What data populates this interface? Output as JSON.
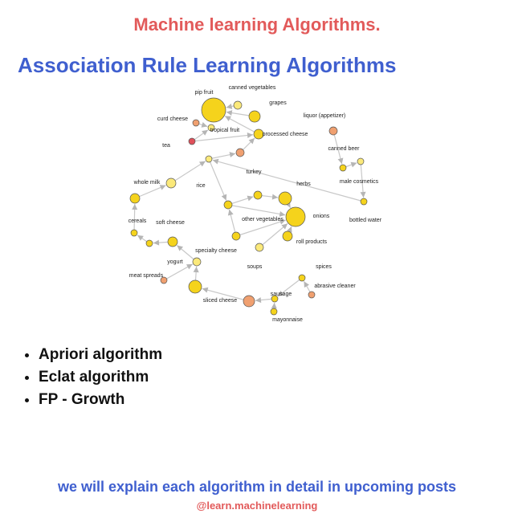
{
  "header": {
    "title": "Machine learning Algorithms.",
    "subtitle": "Association Rule Learning Algorithms"
  },
  "graph": {
    "items": [
      "pip fruit",
      "canned vegetables",
      "grapes",
      "liquor (appetizer)",
      "curd cheese",
      "tropical fruit",
      "processed cheese",
      "tea",
      "canned beer",
      "turkey",
      "male cosmetics",
      "whole milk",
      "rice",
      "herbs",
      "bottled water",
      "other vegetables",
      "onions",
      "cereals",
      "soft cheese",
      "roll products",
      "specialty cheese",
      "soups",
      "spices",
      "yogurt",
      "meat spreads",
      "abrasive cleaner",
      "sausage",
      "sliced cheese",
      "mayonnaise"
    ],
    "colors": {
      "light": "#fbe97a",
      "yellow": "#f5d31c",
      "orange": "#f0a070",
      "red": "#e0505a",
      "edge": "#c8c8c8"
    }
  },
  "algorithms": [
    "Apriori algorithm",
    "Eclat algorithm",
    "FP - Growth"
  ],
  "footer": {
    "note": "we will explain each algorithm in detail in upcoming posts",
    "handle": "@learn.machinelearning"
  }
}
